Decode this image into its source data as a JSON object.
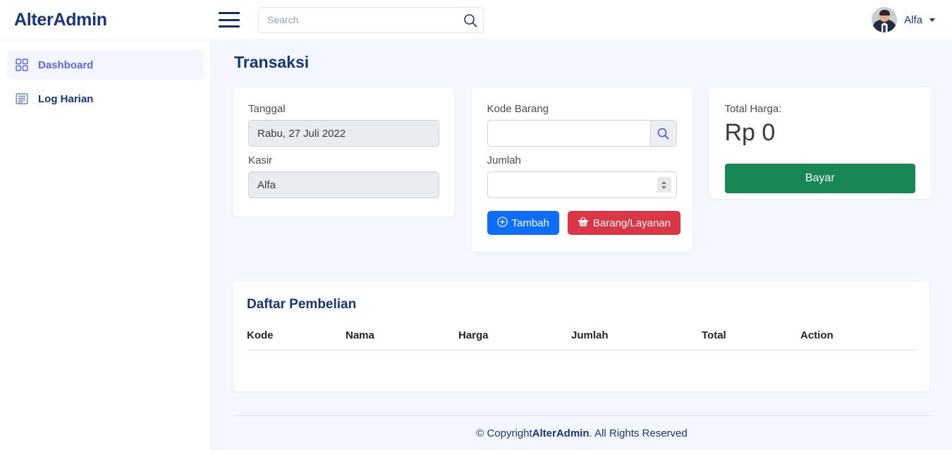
{
  "topbar": {
    "brand": "AlterAdmin",
    "menu_icon": "hamburger-icon",
    "search": {
      "placeholder": "Search",
      "value": "",
      "icon": "search-icon"
    },
    "user": {
      "name": "Alfa",
      "avatar": "user-avatar",
      "caret": "chevron-down-icon"
    }
  },
  "sidebar": {
    "items": [
      {
        "label": "Dashboard",
        "icon": "grid-icon",
        "active": true
      },
      {
        "label": "Log Harian",
        "icon": "list-icon",
        "active": false
      }
    ]
  },
  "main": {
    "page_title": "Transaksi",
    "card_transaksi": {
      "tanggal_label": "Tanggal",
      "tanggal_value": "Rabu, 27 Juli 2022",
      "kasir_label": "Kasir",
      "kasir_value": "Alfa"
    },
    "card_barang": {
      "kode_label": "Kode Barang",
      "kode_value": "",
      "kode_search_icon": "search-icon",
      "jumlah_label": "Jumlah",
      "jumlah_value": "",
      "tambah_label": "Tambah",
      "tambah_icon": "plus-circle-icon",
      "barang_label": "Barang/Layanan",
      "barang_icon": "basket-icon"
    },
    "card_total": {
      "label": "Total Harga:",
      "amount": "Rp 0",
      "pay_label": "Bayar"
    },
    "table": {
      "title": "Daftar Pembelian",
      "columns": [
        "Kode",
        "Nama",
        "Harga",
        "Jumlah",
        "Total",
        "Action"
      ],
      "rows": []
    }
  },
  "footer": {
    "copyright_prefix": "© Copyright ",
    "brand": "AlterAdmin",
    "copyright_suffix": ". All Rights Reserved"
  },
  "colors": {
    "navy": "#16357a",
    "accent": "#5866f2",
    "primary": "#0d6efd",
    "danger": "#dc3545",
    "success": "#198754",
    "page_bg": "#f4f7fd"
  }
}
